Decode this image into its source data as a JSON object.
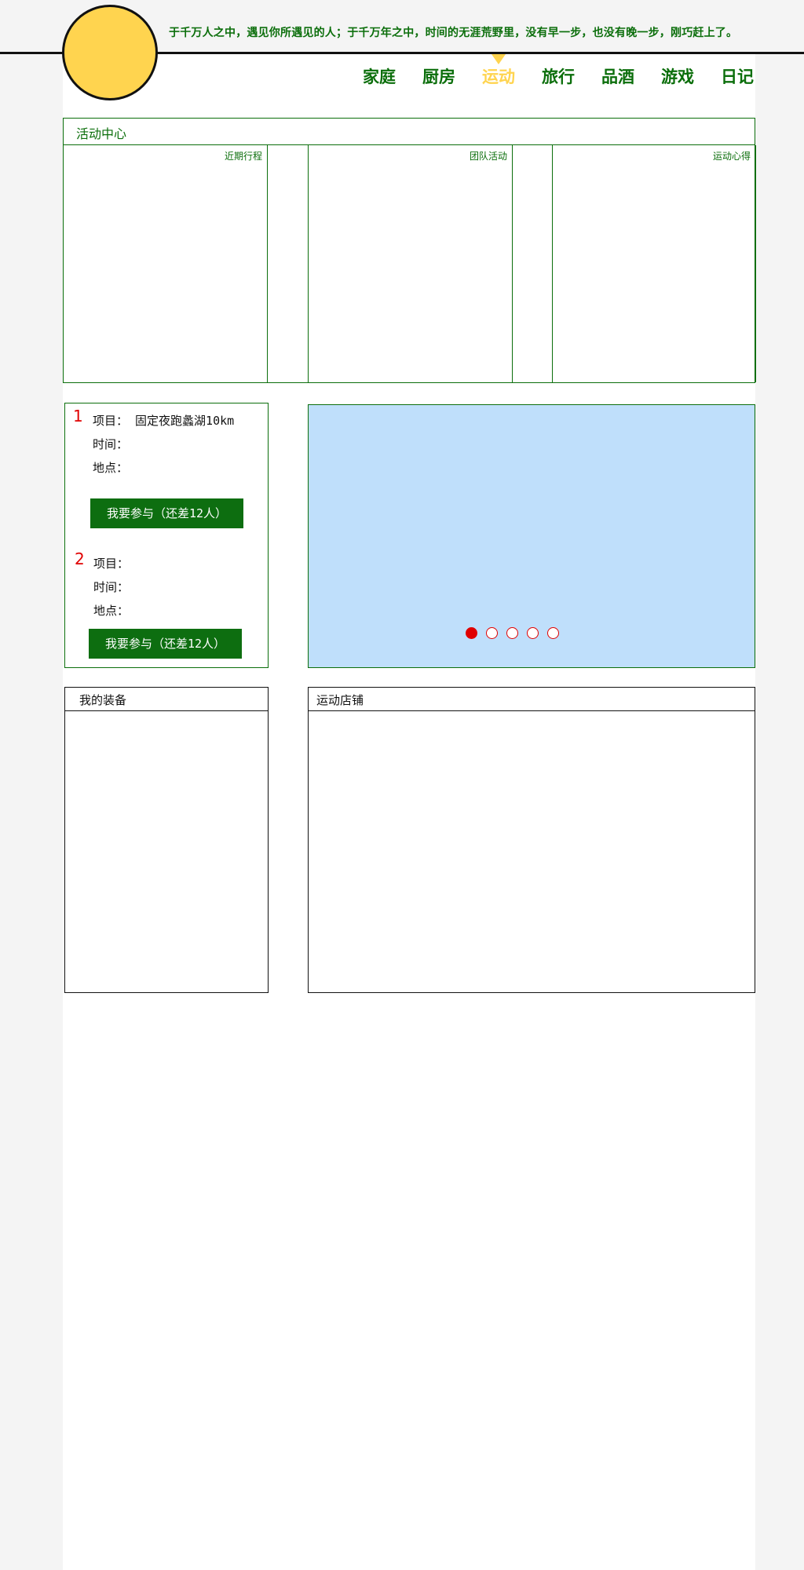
{
  "header": {
    "motto": "于千万人之中，遇见你所遇见的人；于千万年之中，时间的无涯荒野里，没有早一步，也没有晚一步，刚巧赶上了。"
  },
  "nav": {
    "items": [
      "家庭",
      "厨房",
      "运动",
      "旅行",
      "品酒",
      "游戏",
      "日记"
    ],
    "active": "运动"
  },
  "activity_center": {
    "title": "活动中心",
    "columns": [
      "近期行程",
      "团队活动",
      "运动心得"
    ]
  },
  "plans": [
    {
      "number": "1",
      "project_label": "项目：",
      "project_value": "固定夜跑蠡湖10km",
      "time_label": "时间：",
      "place_label": "地点：",
      "button": "我要参与（还差12人）"
    },
    {
      "number": "2",
      "project_label": "项目：",
      "project_value": "",
      "time_label": "时间：",
      "place_label": "地点：",
      "button": "我要参与（还差12人）"
    }
  ],
  "carousel": {
    "dot_count": 5,
    "active_index": 0,
    "background": "#bfdffb"
  },
  "panels": {
    "equipment_title": "我的装备",
    "shop_title": "运动店铺"
  },
  "colors": {
    "brand_green": "#0b6e0b",
    "button_green": "#0d6e10",
    "accent_yellow": "#ffd44f",
    "number_red": "#e00000"
  }
}
